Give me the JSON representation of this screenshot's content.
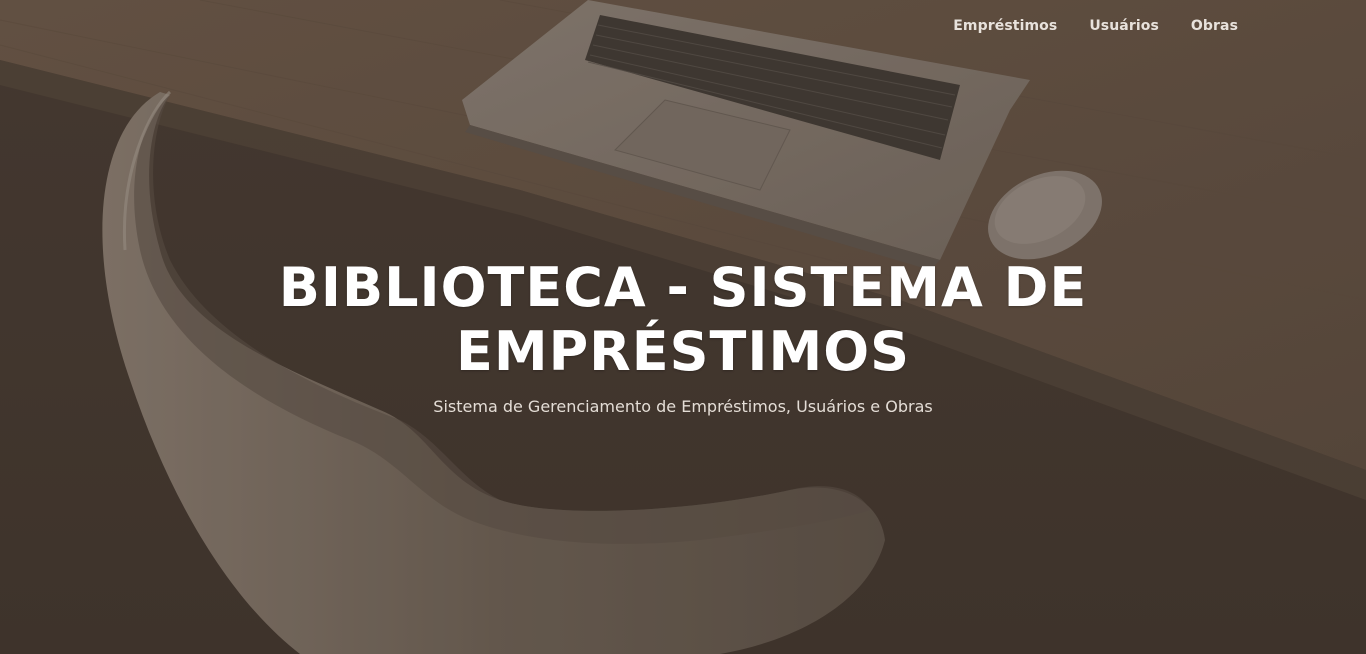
{
  "nav": {
    "items": [
      {
        "label": "Empréstimos"
      },
      {
        "label": "Usuários"
      },
      {
        "label": "Obras"
      }
    ]
  },
  "hero": {
    "title": "BIBLIOTECA - SISTEMA DE EMPRÉSTIMOS",
    "subtitle": "Sistema de Gerenciamento de Empréstimos, Usuários e Obras"
  },
  "colors": {
    "overlay": "#4a3e36",
    "desk": "#6b5647",
    "text": "#ffffff"
  }
}
